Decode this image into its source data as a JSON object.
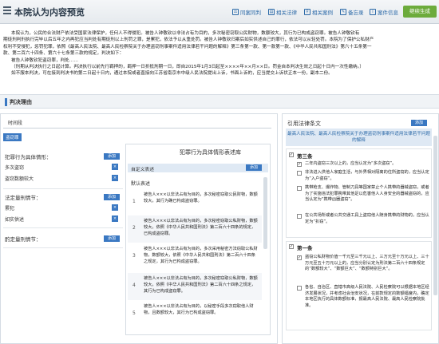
{
  "header": {
    "title": "本院认为内容预览",
    "toolbar": [
      {
        "label": "同案同判",
        "icon": "scales-icon"
      },
      {
        "label": "相关法律",
        "icon": "book-icon"
      },
      {
        "label": "相关案例",
        "icon": "search-icon"
      },
      {
        "label": "备忘录",
        "icon": "memo-icon"
      },
      {
        "label": "案件信息",
        "icon": "info-icon"
      }
    ],
    "generate_label": "继续生成"
  },
  "preview": {
    "lines": [
      "本院认为，公民的合法财产依法受国家法律保护，任何人不得侵犯。被告人钟敬钦以非法占有为目的，多次秘密窃取公民财物，数额较大，其行为已构成盗窃罪。被告人钟敬钦有",
      "期徒刑判刑执行完毕以后五年之内再犯应当判处有期徒刑以上刑罚之罪，是累犯，依法予以从重处罚。被告人钟敬钦归案后如实供述自己的罪行，依法可以从轻处罚。本院为了保护公私财产",
      "权利不受侵犯，惩罚犯罪，依照《最高人民法院、最高人民检察院关于办理盗窃刑事案件适用法律若干问题的解释》第三条第一款、第一款第一款、《中华人民共和国刑法》第六十五条第一",
      "款、第二百六十四条、第六十七条第三款的规定，判决如下：",
      "被告人钟敬钦犯盗窃罪，判处……",
      "（刑期从判决执行之日起计算。判决执行以前先行羁押的，羁押一日折抵刑期一日，即自2015年1月3日起至××××年××月××日。罚金自本判决生效之日起十日内一次性缴纳。）",
      "如不服本判决，可在接到判决书的第二日起十日内，通过本院或者直接向江苏省南京市中级人民法院提出上诉，书面上诉的，应当提交上诉状正本一份，副本二份。"
    ]
  },
  "reason_section": {
    "title": "判决理由"
  },
  "left_panel": {
    "tab_label": "时间段",
    "tag_label": "盗窃罪",
    "groups": [
      {
        "title": "犯罪行为具体情形：",
        "add_label": "添加",
        "items": [
          "多次盗窃",
          "盗窃数额较大"
        ]
      },
      {
        "title": "法定量刑情节：",
        "add_label": "添加",
        "items": [
          "累犯",
          "如实供述"
        ]
      },
      {
        "title": "酌定量刑情节：",
        "add_label": "添加",
        "items": []
      }
    ]
  },
  "expression_panel": {
    "title": "犯罪行为具体情形表述库",
    "custom_label": "自定义表述",
    "custom_add": "添加",
    "default_label": "默认表述",
    "items": [
      {
        "n": "1",
        "text": "被告人×××以非法占有为目的，多次秘密窃取公民财物，数额较大，其行为确已构成盗窃罪。"
      },
      {
        "n": "2",
        "text": "被告人×××以非法占有为目的，多次秘密窃取公私财物，数额较大，依照《中华人民共和国刑法》第二百六十四条的规定，已构成盗窃罪。"
      },
      {
        "n": "3",
        "text": "被告人×××以非法占有为目的，多次采用秘密方法窃取公私财物，数额较大，依照《中华人民共和国刑法》第二百六十四条之规定，其行为已构成盗窃罪。"
      },
      {
        "n": "4",
        "text": "被告人×××以非法占有为目的，多次秘密窃取公私财物，数额较大，依照《中华人民共和国刑法》第二百六十四条之规定，其行为已构成盗窃罪。"
      },
      {
        "n": "5",
        "text": "被告人×××以非法占有为目的，以秘密手段多次窃取他人财物，且数额较大，其行为已构成盗窃罪。"
      }
    ]
  },
  "law_panel": {
    "title": "引用法律条文",
    "add_label": "添加",
    "head": "最高人民法院、最高人民检察院关于办理盗窃刑事案件适用法律若干问题的解释",
    "articles": [
      {
        "name": "第三条",
        "clauses": [
          "二年内盗窃三次以上的，应当认定为“多次盗窃”。",
          "非法进入供他人家庭生活，与外界相对隔离的住所盗窃的，应当认定为“入户盗窃”。",
          "携带枪支、爆炸物、管制刀具等国家禁止个人携带的器械盗窃，或者为了实施违法犯罪携带其他足以危害他人人身安全的器械盗窃的，应当认定为“携带凶器盗窃”。",
          "在公共场所或者公共交通工具上盗窃他人随身携带的财物的，应当认定为“扒窃”。"
        ]
      },
      {
        "name": "第一条",
        "clauses": [
          "盗窃公私财物价值一千元至三千元以上、三万元至十万元以上、三十万元至五十万元以上的，应当分别认定为刑法第二百六十四条规定的“数额较大”、“数额巨大”、“数额特别巨大”。",
          "各省、自治区、直辖市高级人民法院、人民检察院可以根据本地区经济发展状况，并考虑社会治安状况，在前款规定的数额幅度内，确定本地区执行的具体数额标准，报最高人民法院、最高人民检察院批准。"
        ]
      }
    ]
  },
  "colors": {
    "accent": "#3a78c2",
    "generate": "#6cab3c",
    "link": "#2c6aa8"
  }
}
